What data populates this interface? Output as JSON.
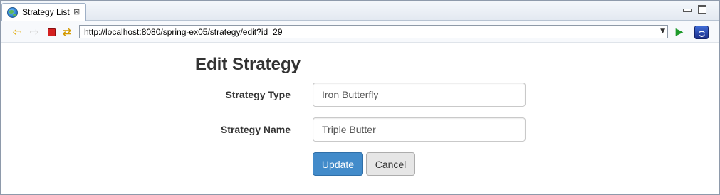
{
  "tab": {
    "title": "Strategy List",
    "close_glyph": "⊠"
  },
  "toolbar": {
    "url": "http://localhost:8080/spring-ex05/strategy/edit?id=29",
    "back_glyph": "⇦",
    "forward_glyph": "⇨",
    "refresh_glyph": "⇄",
    "go_glyph": "▶",
    "dropdown_glyph": "▼"
  },
  "page": {
    "title": "Edit Strategy"
  },
  "form": {
    "strategy_type_label": "Strategy Type",
    "strategy_type_value": "Iron Butterfly",
    "strategy_name_label": "Strategy Name",
    "strategy_name_value": "Triple Butter",
    "update_label": "Update",
    "cancel_label": "Cancel"
  },
  "colors": {
    "primary_button": "#428bca",
    "default_button": "#e6e6e6",
    "stop_icon": "#d42020",
    "go_icon": "#1e9a2a"
  }
}
